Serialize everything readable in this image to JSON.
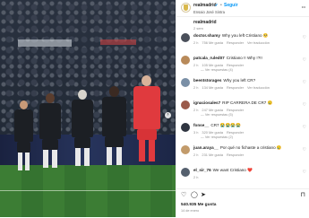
{
  "header": {
    "username": "realmadrid",
    "verified": "✔",
    "separator": "•",
    "follow_label": "Seguir",
    "subtitle": "Ensaio José Sintra",
    "more": "•••"
  },
  "caption": {
    "user": "realmadrid",
    "time": "2 sem"
  },
  "comments": [
    {
      "user": "doctor.shamy",
      "text": "Why you left Cristiano",
      "emoji": "🥺",
      "time": "2 h",
      "likes": "756 Me gusta",
      "reply": "Responder",
      "translate": "Ver traducción",
      "replies": "",
      "avatar": "#4a4f5a"
    },
    {
      "user": "patcala_ruled07",
      "text": "Cristiano !! Why !?!!",
      "emoji": "",
      "time": "2 h",
      "likes": "105 Me gusta",
      "reply": "Responder",
      "translate": "",
      "replies": "— Ver respuestas (4)",
      "avatar": "#b88a5a"
    },
    {
      "user": "beentstorages",
      "text": "Why you left CR?",
      "emoji": "",
      "time": "2 h",
      "likes": "134 Me gusta",
      "reply": "Responder",
      "translate": "Ver traducción",
      "replies": "",
      "avatar": "#7a8fa6"
    },
    {
      "user": "ignaciosales7",
      "text": "RIP CARRERA DE CR7",
      "emoji": "😢",
      "time": "2 h",
      "likes": "247 Me gusta",
      "reply": "Responder",
      "translate": "",
      "replies": "— Ver respuestas (5)",
      "avatar": "#9a5a4a"
    },
    {
      "user": "fonse__",
      "text": "CR7",
      "emoji": "😭😭😭😭",
      "time": "3 h",
      "likes": "320 Me gusta",
      "reply": "Responder",
      "translate": "",
      "replies": "— Ver respuestas (2)",
      "avatar": "#2f3540"
    },
    {
      "user": "juan.araya__",
      "text": "Por qué no fichaste a cristiano",
      "emoji": "😢",
      "time": "2 h",
      "likes": "231 Me gusta",
      "reply": "Responder",
      "translate": "",
      "replies": "",
      "avatar": "#c29b6b"
    },
    {
      "user": "el_sir_76",
      "text": "We want Cristiano",
      "emoji": "❤️",
      "time": "2 h",
      "likes": "",
      "reply": "",
      "translate": "",
      "replies": "",
      "avatar": "#55606e"
    }
  ],
  "actions": {
    "like_icon": "heart-icon",
    "comment_icon": "comment-icon",
    "share_icon": "send-icon",
    "save_icon": "bookmark-icon",
    "likes_text": "540.935 Me gusta",
    "posted": "14 de enero"
  },
  "colors": {
    "follow": "#0095f6",
    "madrid_white": "#ffffff",
    "keeper_red": "#e03a3e"
  }
}
